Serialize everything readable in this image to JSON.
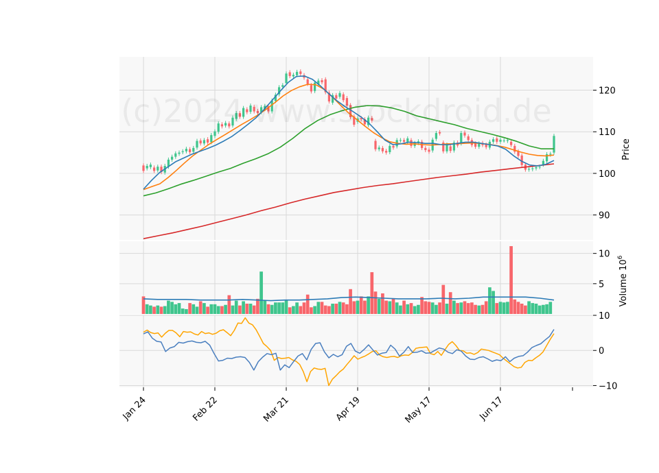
{
  "watermark": "(c)2024 www.stockdroid.de",
  "chart_data": {
    "type": "candlestick",
    "x_tick_labels": [
      "Jan 24",
      "Feb 22",
      "Mar 21",
      "Apr 19",
      "May 17",
      "Jun 17"
    ],
    "x_tick_index": [
      0,
      20,
      40,
      60,
      80,
      100
    ],
    "price_panel": {
      "ylabel": "Price",
      "ylim": [
        84,
        128
      ],
      "yticks": [
        90,
        100,
        110,
        120
      ],
      "candles": [
        [
          101.9,
          100.6
        ],
        [
          101.2,
          101.8
        ],
        [
          101.5,
          102.1
        ],
        [
          101.4,
          100.6
        ],
        [
          100.7,
          101.6
        ],
        [
          101.6,
          100.3
        ],
        [
          100.2,
          101.8
        ],
        [
          101.6,
          103.3
        ],
        [
          103.3,
          104.0
        ],
        [
          104.0,
          104.8
        ],
        [
          104.7,
          105.0
        ],
        [
          105.1,
          105.3
        ],
        [
          105.3,
          105.9
        ],
        [
          105.8,
          105.1
        ],
        [
          105.2,
          106.1
        ],
        [
          106.2,
          107.8
        ],
        [
          107.9,
          107.2
        ],
        [
          107.2,
          108.0
        ],
        [
          108.2,
          107.4
        ],
        [
          107.5,
          109.2
        ],
        [
          109.0,
          110.1
        ],
        [
          110.0,
          112.0
        ],
        [
          111.8,
          111.3
        ],
        [
          111.5,
          112.1
        ],
        [
          112.0,
          111.3
        ],
        [
          111.5,
          113.4
        ],
        [
          113.1,
          114.5
        ],
        [
          114.5,
          113.6
        ],
        [
          113.6,
          115.7
        ],
        [
          115.4,
          114.7
        ],
        [
          114.8,
          116.3
        ],
        [
          116.0,
          114.9
        ],
        [
          115.0,
          114.5
        ],
        [
          114.7,
          115.9
        ],
        [
          115.5,
          116.2
        ],
        [
          116.1,
          114.9
        ],
        [
          114.9,
          117.5
        ],
        [
          117.4,
          118.9
        ],
        [
          119.0,
          120.7
        ],
        [
          120.8,
          121.2
        ],
        [
          121.7,
          124.0
        ],
        [
          124.3,
          123.4
        ],
        [
          123.3,
          123.7
        ],
        [
          123.6,
          124.4
        ],
        [
          124.5,
          123.9
        ],
        [
          123.6,
          123.0
        ],
        [
          122.6,
          121.5
        ],
        [
          121.2,
          119.7
        ],
        [
          119.8,
          121.8
        ],
        [
          121.4,
          122.3
        ],
        [
          122.4,
          121.9
        ],
        [
          122.6,
          119.5
        ],
        [
          119.4,
          117.3
        ],
        [
          117.0,
          118.8
        ],
        [
          118.8,
          118.0
        ],
        [
          118.4,
          119.3
        ],
        [
          119.0,
          117.6
        ],
        [
          118.1,
          116.3
        ],
        [
          116.4,
          113.5
        ],
        [
          113.7,
          111.7
        ],
        [
          112.4,
          113.2
        ],
        [
          113.3,
          113.0
        ],
        [
          113.0,
          111.8
        ],
        [
          111.6,
          113.4
        ],
        [
          113.3,
          112.7
        ],
        [
          107.8,
          105.8
        ],
        [
          105.8,
          106.2
        ],
        [
          106.1,
          105.3
        ],
        [
          105.4,
          105.0
        ],
        [
          105.1,
          106.6
        ],
        [
          106.6,
          106.2
        ],
        [
          106.5,
          108.0
        ],
        [
          107.9,
          108.0
        ],
        [
          108.0,
          107.6
        ],
        [
          107.5,
          108.4
        ],
        [
          108.0,
          106.6
        ],
        [
          106.6,
          107.3
        ],
        [
          107.3,
          107.7
        ],
        [
          107.6,
          106.1
        ],
        [
          106.1,
          105.6
        ],
        [
          105.7,
          105.2
        ],
        [
          105.5,
          108.1
        ],
        [
          108.3,
          109.7
        ],
        [
          109.9,
          109.6
        ],
        [
          107.4,
          105.3
        ],
        [
          105.3,
          106.9
        ],
        [
          106.5,
          105.4
        ],
        [
          105.5,
          107.4
        ],
        [
          107.4,
          106.7
        ],
        [
          107.2,
          109.7
        ],
        [
          109.8,
          109.1
        ],
        [
          108.9,
          108.0
        ],
        [
          108.0,
          106.8
        ],
        [
          107.2,
          106.4
        ],
        [
          106.4,
          107.2
        ],
        [
          107.3,
          106.8
        ],
        [
          106.9,
          106.3
        ],
        [
          106.2,
          107.6
        ],
        [
          107.6,
          108.2
        ],
        [
          108.4,
          107.6
        ],
        [
          107.6,
          108.1
        ],
        [
          107.9,
          107.9
        ],
        [
          107.8,
          108.0
        ],
        [
          107.6,
          106.8
        ],
        [
          106.6,
          105.2
        ],
        [
          105.3,
          104.2
        ],
        [
          104.3,
          102.0
        ],
        [
          102.1,
          100.9
        ],
        [
          100.9,
          101.1
        ],
        [
          101.0,
          101.2
        ],
        [
          101.2,
          101.5
        ],
        [
          101.5,
          101.6
        ],
        [
          102.1,
          103.0
        ],
        [
          102.9,
          104.6
        ],
        [
          104.5,
          104.7
        ],
        [
          105.0,
          109.0
        ]
      ],
      "sma_blue": [
        96.2,
        98.3,
        100.2,
        101.5,
        102.8,
        103.7,
        104.6,
        105.3,
        106.0,
        106.8,
        107.8,
        108.9,
        110.3,
        111.8,
        113.4,
        115.4,
        117.6,
        119.8,
        121.9,
        123.3,
        123.4,
        122.6,
        121.0,
        119.2,
        117.5,
        116.1,
        114.9,
        113.6,
        112.1,
        110.1,
        108.0,
        106.9,
        107.1,
        107.5,
        107.4,
        107.2,
        107.2,
        106.9,
        106.9,
        107.2,
        107.5,
        107.5,
        107.2,
        106.9,
        106.6,
        105.8,
        104.2,
        102.9,
        102.0,
        101.8,
        102.2,
        103.1
      ],
      "sma_orange": [
        96.1,
        96.8,
        97.5,
        99.0,
        100.7,
        102.5,
        104.2,
        105.6,
        107.0,
        108.2,
        109.4,
        110.6,
        111.8,
        112.9,
        114.1,
        115.5,
        117.0,
        118.6,
        119.9,
        120.8,
        121.4,
        121.3,
        120.2,
        118.4,
        116.4,
        114.5,
        112.9,
        111.3,
        109.8,
        108.6,
        107.6,
        107.2,
        107.0,
        107.1,
        106.9,
        106.8,
        106.9,
        107.1,
        107.1,
        107.2,
        107.3,
        107.2,
        107.0,
        106.7,
        106.3,
        105.7,
        105.1,
        104.6,
        104.3,
        104.2,
        104.4
      ],
      "sma_green": [
        94.6,
        95.3,
        96.3,
        97.4,
        98.3,
        99.3,
        100.3,
        101.2,
        102.4,
        103.5,
        104.7,
        106.3,
        108.4,
        110.8,
        112.7,
        114.1,
        115.1,
        115.9,
        116.3,
        116.2,
        115.7,
        114.9,
        113.8,
        113.1,
        112.4,
        111.7,
        110.8,
        110.1,
        109.4,
        108.6,
        107.7,
        106.6,
        105.9,
        105.9
      ],
      "sma_red": [
        84.3,
        85.0,
        85.7,
        86.5,
        87.3,
        88.2,
        89.1,
        90.0,
        91.0,
        91.9,
        92.9,
        93.8,
        94.6,
        95.4,
        96.0,
        96.6,
        97.1,
        97.5,
        98.0,
        98.5,
        99.0,
        99.4,
        99.8,
        100.3,
        100.7,
        101.1,
        101.5,
        101.9,
        102.3
      ]
    },
    "volume_panel": {
      "ylabel": "Volume  10^6",
      "ylim": [
        0,
        12
      ],
      "yticks": [
        5,
        10
      ],
      "values": [
        2.9,
        1.6,
        1.4,
        1.2,
        1.4,
        1.2,
        1.3,
        2.2,
        2.0,
        1.6,
        1.8,
        0.9,
        0.8,
        1.8,
        1.6,
        1.2,
        2.1,
        1.8,
        1.2,
        1.6,
        1.6,
        1.3,
        1.3,
        1.5,
        3.1,
        1.4,
        2.2,
        1.4,
        2.1,
        1.7,
        1.7,
        1.4,
        2.5,
        7.0,
        2.2,
        1.6,
        1.5,
        1.9,
        1.9,
        1.9,
        2.2,
        1.1,
        1.3,
        1.9,
        1.3,
        1.9,
        3.2,
        1.1,
        1.3,
        2.0,
        2.0,
        1.4,
        1.3,
        1.7,
        1.7,
        2.0,
        1.9,
        1.6,
        4.1,
        2.1,
        2.2,
        2.9,
        2.2,
        2.9,
        6.9,
        3.7,
        2.5,
        3.4,
        2.2,
        2.1,
        2.5,
        1.9,
        1.4,
        2.2,
        1.6,
        1.8,
        1.3,
        1.5,
        2.8,
        2.1,
        2.0,
        1.9,
        1.5,
        1.9,
        4.8,
        1.7,
        3.6,
        2.2,
        1.8,
        1.9,
        2.1,
        1.8,
        1.9,
        1.5,
        1.4,
        1.5,
        2.1,
        4.4,
        3.8,
        1.8,
        2.0,
        1.9,
        2.0,
        11.2,
        2.4,
        2.0,
        1.7,
        1.4,
        2.1,
        1.8,
        1.7,
        1.4,
        1.5,
        1.6,
        2.0
      ],
      "avg": [
        2.5,
        2.4,
        2.4,
        2.4,
        2.3,
        2.3,
        2.3,
        2.4,
        2.3,
        2.2,
        2.3,
        2.3,
        2.4,
        2.5,
        2.7,
        2.8,
        2.7,
        2.6,
        2.5,
        2.5,
        2.5,
        2.6,
        2.5,
        2.6,
        2.8,
        2.8,
        2.8,
        2.8,
        2.6,
        2.3
      ]
    },
    "oscillator_panel": {
      "ylim": [
        -10.5,
        10
      ],
      "yticks": [
        -10,
        0,
        10
      ],
      "macd": [
        4.7,
        5.3,
        3.5,
        2.6,
        2.4,
        -0.3,
        0.7,
        1.1,
        2.3,
        2.1,
        2.5,
        2.7,
        2.3,
        2.2,
        2.6,
        1.5,
        -0.9,
        -3.0,
        -2.8,
        -2.2,
        -2.3,
        -1.9,
        -1.8,
        -2.0,
        -3.4,
        -5.6,
        -3.2,
        -1.9,
        -0.9,
        -1.2,
        -0.8,
        -5.6,
        -4.1,
        -4.9,
        -3.2,
        -1.6,
        -0.9,
        -2.7,
        0.3,
        2.0,
        2.2,
        -0.4,
        -2.1,
        -1.1,
        -1.8,
        -1.2,
        1.2,
        2.0,
        -0.2,
        -0.8,
        0.3,
        1.6,
        0.1,
        -1.3,
        -0.8,
        -0.6,
        1.5,
        0.4,
        -1.6,
        -0.5,
        1.1,
        -0.6,
        -0.5,
        -0.1,
        -0.8,
        -0.7,
        0.0,
        0.7,
        0.4,
        -0.5,
        -0.9,
        0.2,
        -0.2,
        -1.6,
        -2.5,
        -2.6,
        -2.0,
        -1.8,
        -2.4,
        -3.1,
        -2.7,
        -2.9,
        -1.8,
        -3.2,
        -2.2,
        -1.7,
        -1.5,
        -0.5,
        0.8,
        1.4,
        1.9,
        3.0,
        4.0,
        6.0
      ],
      "signal": [
        5.2,
        5.8,
        5.1,
        4.8,
        5.0,
        3.8,
        4.9,
        5.7,
        5.7,
        5.0,
        3.9,
        5.4,
        5.2,
        5.3,
        4.7,
        4.4,
        5.4,
        4.8,
        5.0,
        4.6,
        4.9,
        5.6,
        5.9,
        5.1,
        4.2,
        5.7,
        7.8,
        7.7,
        9.3,
        7.8,
        7.3,
        5.9,
        4.0,
        2.0,
        1.1,
        0.0,
        -2.8,
        -2.0,
        -2.3,
        -2.2,
        -2.0,
        -2.7,
        -3.1,
        -4.0,
        -6.0,
        -8.9,
        -6.0,
        -5.0,
        -5.3,
        -5.4,
        -5.1,
        -10.0,
        -8.2,
        -7.2,
        -6.1,
        -5.3,
        -4.0,
        -2.8,
        -1.5,
        -2.5,
        -2.0,
        -1.6,
        -1.0,
        -0.3,
        -0.1,
        -1.3,
        -1.8,
        -2.0,
        -1.8,
        -1.7,
        -2.0,
        -1.5,
        -1.3,
        -1.4,
        -0.6,
        0.6,
        0.8,
        0.9,
        1.0,
        -0.9,
        -1.2,
        -0.3,
        -1.4,
        0.2,
        1.7,
        2.5,
        1.4,
        0.0,
        -0.1,
        -0.8,
        -0.7,
        -1.1,
        -0.6,
        0.4,
        0.2,
        0.0,
        -0.4,
        -0.8,
        -1.2,
        -2.2,
        -3.0,
        -3.8,
        -4.6,
        -5.0,
        -4.8,
        -3.4,
        -2.8,
        -2.9,
        -2.1,
        -1.4,
        -0.4,
        1.4,
        3.2,
        4.8
      ]
    }
  },
  "colors": {
    "up": "#3fc58d",
    "down": "#f8666b",
    "sma_blue": "#2c7bb6",
    "sma_orange": "#ff7f0e",
    "sma_green": "#2ca02c",
    "sma_red": "#d62728",
    "vol_avg": "#2c7bb6",
    "macd": "#4a7fbf",
    "signal": "#ffa500",
    "grid": "#d9d9d9",
    "panel_bg": "#f8f8f8"
  }
}
